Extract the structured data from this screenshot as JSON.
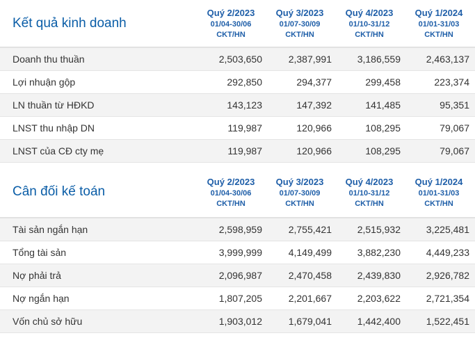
{
  "sections": [
    {
      "title": "Kết quả kinh doanh",
      "quarters": [
        {
          "title": "Quý 2/2023",
          "range": "01/04-30/06",
          "status": "CKT/HN"
        },
        {
          "title": "Quý 3/2023",
          "range": "01/07-30/09",
          "status": "CKT/HN"
        },
        {
          "title": "Quý 4/2023",
          "range": "01/10-31/12",
          "status": "CKT/HN"
        },
        {
          "title": "Quý 1/2024",
          "range": "01/01-31/03",
          "status": "CKT/HN"
        }
      ],
      "rows": [
        {
          "label": "Doanh thu thuần",
          "values": [
            "2,503,650",
            "2,387,991",
            "3,186,559",
            "2,463,137"
          ]
        },
        {
          "label": "Lợi nhuận gộp",
          "values": [
            "292,850",
            "294,377",
            "299,458",
            "223,374"
          ]
        },
        {
          "label": "LN thuần từ HĐKD",
          "values": [
            "143,123",
            "147,392",
            "141,485",
            "95,351"
          ]
        },
        {
          "label": "LNST thu nhập DN",
          "values": [
            "119,987",
            "120,966",
            "108,295",
            "79,067"
          ]
        },
        {
          "label": "LNST của CĐ cty mẹ",
          "values": [
            "119,987",
            "120,966",
            "108,295",
            "79,067"
          ]
        }
      ]
    },
    {
      "title": "Cân đối kế toán",
      "quarters": [
        {
          "title": "Quý 2/2023",
          "range": "01/04-30/06",
          "status": "CKT/HN"
        },
        {
          "title": "Quý 3/2023",
          "range": "01/07-30/09",
          "status": "CKT/HN"
        },
        {
          "title": "Quý 4/2023",
          "range": "01/10-31/12",
          "status": "CKT/HN"
        },
        {
          "title": "Quý 1/2024",
          "range": "01/01-31/03",
          "status": "CKT/HN"
        }
      ],
      "rows": [
        {
          "label": "Tài sản ngắn hạn",
          "values": [
            "2,598,959",
            "2,755,421",
            "2,515,932",
            "3,225,481"
          ]
        },
        {
          "label": "Tổng tài sản",
          "values": [
            "3,999,999",
            "4,149,499",
            "3,882,230",
            "4,449,233"
          ]
        },
        {
          "label": "Nợ phải trả",
          "values": [
            "2,096,987",
            "2,470,458",
            "2,439,830",
            "2,926,782"
          ]
        },
        {
          "label": "Nợ ngắn hạn",
          "values": [
            "1,807,205",
            "2,201,667",
            "2,203,622",
            "2,721,354"
          ]
        },
        {
          "label": "Vốn chủ sở hữu",
          "values": [
            "1,903,012",
            "1,679,041",
            "1,442,400",
            "1,522,451"
          ]
        }
      ]
    }
  ]
}
